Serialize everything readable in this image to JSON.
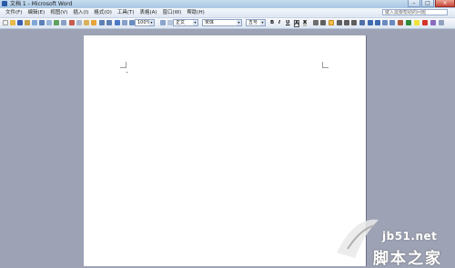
{
  "window": {
    "title": "文档 1 - Microsoft Word",
    "controls": {
      "minimize": "–",
      "maximize": "□",
      "close": "×"
    }
  },
  "menubar": {
    "items": [
      "文件(F)",
      "编辑(E)",
      "视图(V)",
      "插入(I)",
      "格式(O)",
      "工具(T)",
      "表格(A)",
      "窗口(W)",
      "帮助(H)"
    ],
    "help_placeholder": "键入需要帮助的问题"
  },
  "toolbar": {
    "zoom": "100%",
    "style": "正文",
    "font": "宋体",
    "size": "五号",
    "bold": "B",
    "italic": "I",
    "underline": "U",
    "char_border": "A",
    "char_shading": "X"
  },
  "watermark": {
    "site": "jb51.net",
    "name": "脚本之家"
  }
}
